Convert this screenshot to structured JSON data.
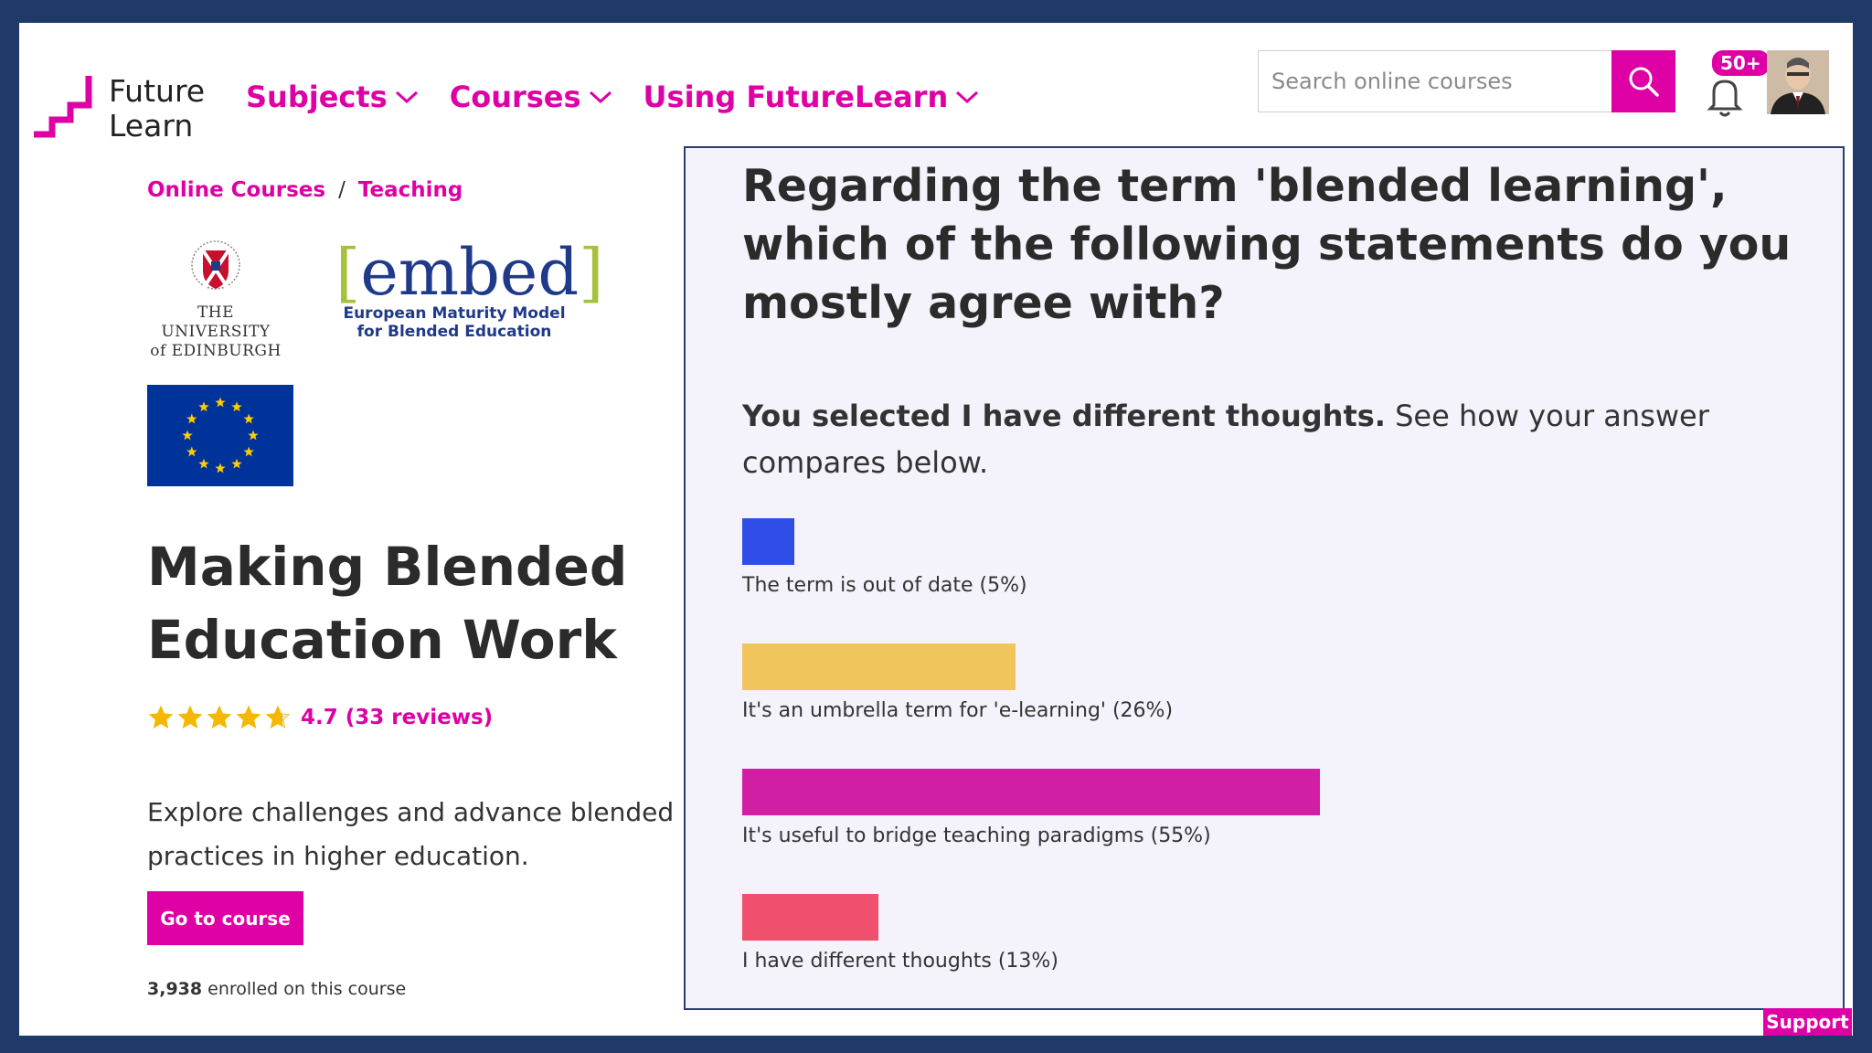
{
  "header": {
    "logo_line1": "Future",
    "logo_line2": "Learn",
    "nav": [
      {
        "label": "Subjects"
      },
      {
        "label": "Courses"
      },
      {
        "label": "Using FutureLearn"
      }
    ],
    "search_placeholder": "Search online courses",
    "notification_count": "50+"
  },
  "breadcrumb": {
    "item1": "Online Courses",
    "sep": "/",
    "item2": "Teaching"
  },
  "logos": {
    "uoe_line1": "THE UNIVERSITY",
    "uoe_line2": "of EDINBURGH",
    "embed_word": "embed",
    "embed_sub1": "European Maturity Model",
    "embed_sub2": "for Blended Education"
  },
  "course": {
    "title_line1": "Making Blended",
    "title_line2": "Education Work",
    "rating": 4.7,
    "rating_text": "4.7 (33 reviews)",
    "description": "Explore challenges and advance blended learning practices in higher education.",
    "cta": "Go to course",
    "enrolled_count": "3,938",
    "enrolled_suffix": " enrolled on this course"
  },
  "poll": {
    "question": "Regarding the term 'blended learning', which of the following statements do you mostly agree with?",
    "selected_prefix": "You selected I have different thoughts.",
    "selected_suffix": " See how your answer compares below.",
    "options": [
      {
        "label": "The term is out of date (5%)",
        "percent": 5,
        "color": "#2e4de6"
      },
      {
        "label": "It's an umbrella term for 'e-learning' (26%)",
        "percent": 26,
        "color": "#f0c55c"
      },
      {
        "label": "It's useful to bridge teaching paradigms (55%)",
        "percent": 55,
        "color": "#d21ea5"
      },
      {
        "label": "I have different thoughts (13%)",
        "percent": 13,
        "color": "#f0506e"
      }
    ]
  },
  "support_label": "Support",
  "colors": {
    "brand": "#de00a5",
    "frame": "#1f3a68"
  }
}
